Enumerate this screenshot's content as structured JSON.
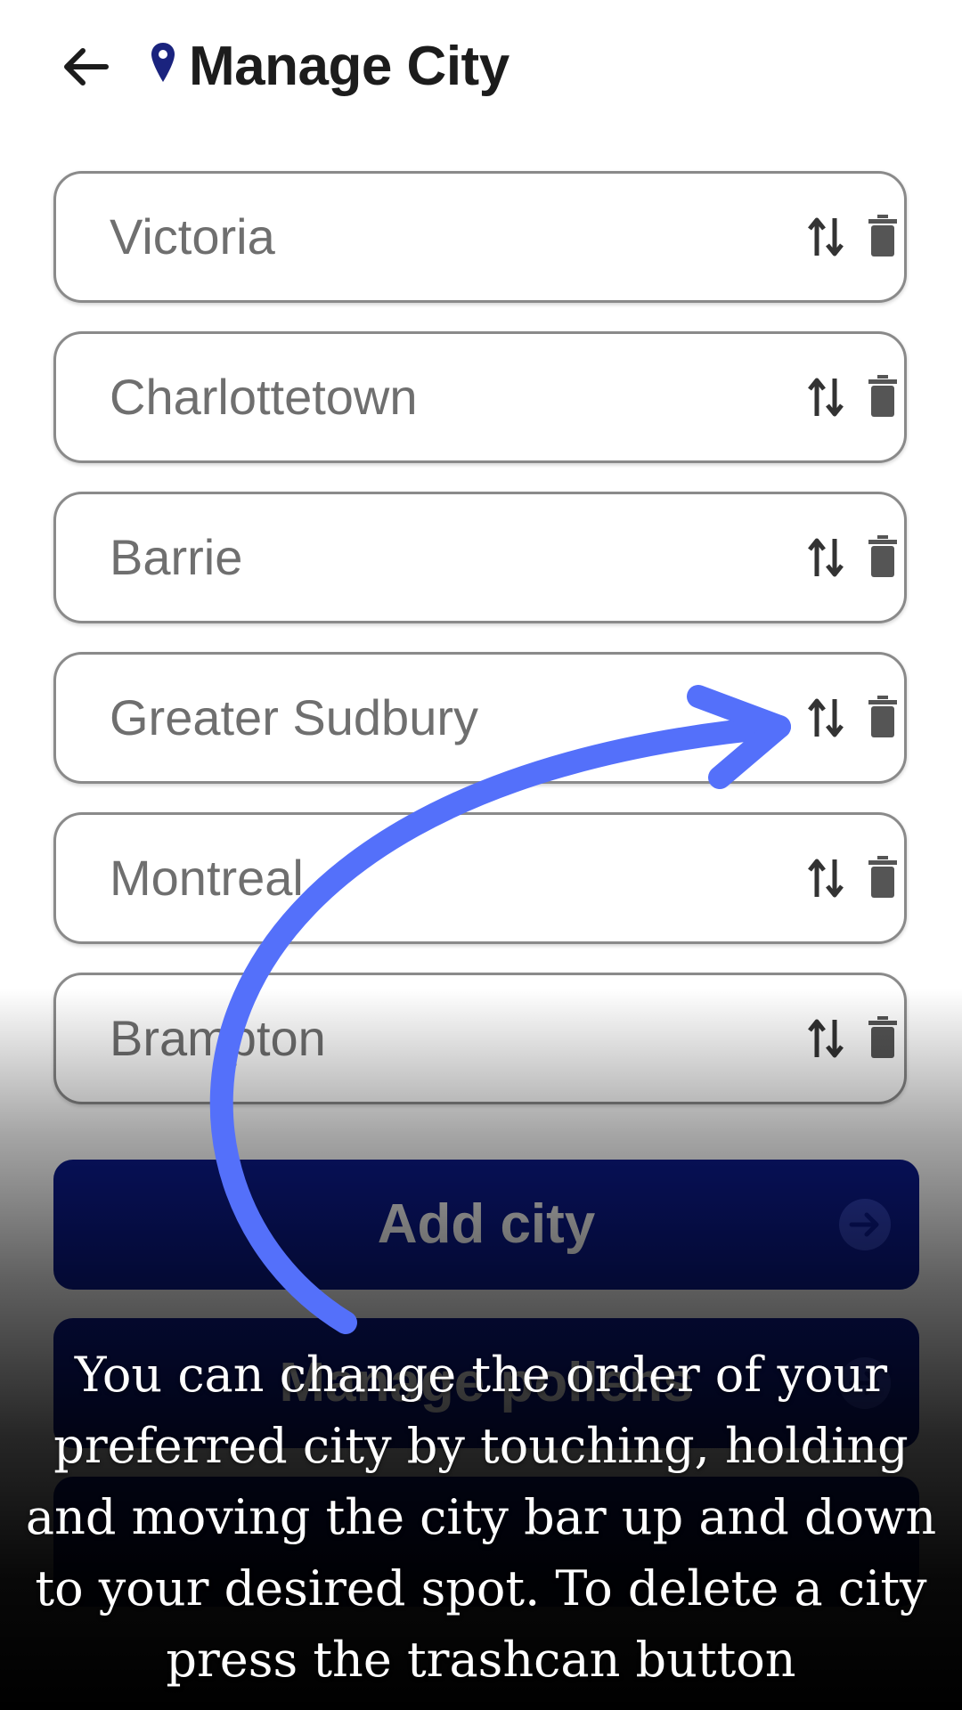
{
  "header": {
    "title": "Manage City",
    "back_icon": "arrow-left-icon",
    "location_icon": "map-pin-icon",
    "location_icon_color": "#1a237e"
  },
  "cities": [
    {
      "name": "Victoria"
    },
    {
      "name": "Charlottetown"
    },
    {
      "name": "Barrie"
    },
    {
      "name": "Greater Sudbury"
    },
    {
      "name": "Montreal"
    },
    {
      "name": "Brampton"
    }
  ],
  "row_icons": {
    "reorder": "swap-vertical-icon",
    "delete": "trash-icon"
  },
  "buttons": {
    "add_city": "Add city",
    "manage_pollens": "Manage pollens",
    "third_label": ""
  },
  "tutorial": {
    "text": "You can change the order of your preferred city by touching, holding and moving the city bar up and down to your desired spot. To delete a city press the trashcan button",
    "arrow_color": "#5470fa"
  },
  "colors": {
    "primary_button": "#0b1a8c",
    "city_text": "#6f6f6f",
    "border": "#8a8a8a"
  }
}
